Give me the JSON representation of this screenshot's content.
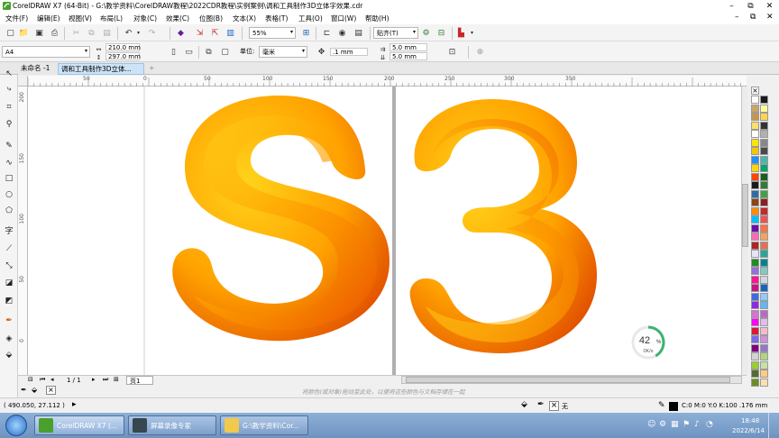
{
  "window": {
    "title": "CorelDRAW X7 (64-Bit) - G:\\教学资料\\CorelDRAW教程\\2022CDR教程\\实例案例\\调和工具制作3D立体字效果.cdr",
    "buttons": {
      "minimize": "–",
      "restore": "⧉",
      "close": "✕"
    }
  },
  "menu": {
    "items": [
      "文件(F)",
      "编辑(E)",
      "视图(V)",
      "布局(L)",
      "对象(C)",
      "效果(C)",
      "位图(B)",
      "文本(X)",
      "表格(T)",
      "工具(O)",
      "窗口(W)",
      "帮助(H)"
    ],
    "right_buttons": {
      "minimize": "–",
      "restore": "⧉",
      "close": "✕"
    }
  },
  "toolbar": {
    "zoom": "55%",
    "snap": "贴齐(T)"
  },
  "propertybar": {
    "page_size": "A4",
    "width": "210.0 mm",
    "height": "297.0 mm",
    "units_label": "单位:",
    "units": "毫米",
    "nudge": ".1 mm",
    "dup_x": "5.0 mm",
    "dup_y": "5.0 mm"
  },
  "tabs": {
    "items": [
      "未命名 -1",
      "调和工具制作3D立体..."
    ],
    "add": "+"
  },
  "rulers": {
    "top": [
      "50",
      "0",
      "50",
      "100",
      "150",
      "200",
      "250",
      "300",
      "350"
    ],
    "left": [
      "200",
      "150",
      "100",
      "50",
      "0"
    ]
  },
  "canvas": {
    "text": "S3",
    "colors": {
      "light": "#ffd21a",
      "mid": "#ffa200",
      "dark": "#ee5a00",
      "deep": "#e04a00"
    }
  },
  "speed": {
    "percent": "42",
    "unit": "%",
    "rate": "0K/s",
    "level": 0.42
  },
  "pagenav": {
    "page_counter": "1 / 1",
    "page_tab": "页1"
  },
  "hint": "将颜色(或对象)拖动至此处，以便将这些颜色与文档存储在一起",
  "status": {
    "coords": "( 490.050, 27.112 )",
    "fill": "无",
    "outline": "C:0 M:0 Y:0 K:100  .176 mm"
  },
  "taskbar": {
    "items": [
      "CorelDRAW X7 (...",
      "屏幕录像专家",
      "G:\\教学资料\\Cor..."
    ],
    "time": "18:48",
    "date": "2022/6/14"
  },
  "palette": {
    "col1": [
      "#ffffff",
      "#c8a56a",
      "#c8964a",
      "#ffe066",
      "#ffffff",
      "#ffe600",
      "#f0c800",
      "#1e90ff",
      "#ffd700",
      "#ff4500",
      "#1a1a1a",
      "#2e6da4",
      "#8b4513",
      "#ff8c00",
      "#00bfff",
      "#6a0dad",
      "#ff69b4",
      "#b22222",
      "#e6e6fa",
      "#228b22",
      "#9370db",
      "#ff1493",
      "#c71585",
      "#4169e1",
      "#8a2be2",
      "#da70d6",
      "#ff00ff",
      "#dc143c",
      "#7b68ee",
      "#800080",
      "#d3d3d3",
      "#9acd32",
      "#556b2f",
      "#6b8e23"
    ],
    "col2": [
      "#1a1a1a",
      "#ffff99",
      "#ffd54f",
      "#333333",
      "#b0b0b0",
      "#888888",
      "#4a4a4a",
      "#4db6ac",
      "#00a86b",
      "#1b5e20",
      "#2e7d32",
      "#43a047",
      "#8e1e1e",
      "#c62828",
      "#ef5350",
      "#ff7043",
      "#f4a261",
      "#e76f51",
      "#26a69a",
      "#00838f",
      "#80cbc4",
      "#cfd8dc",
      "#1565c0",
      "#90caf9",
      "#64b5f6",
      "#ba68c8",
      "#e1bee7",
      "#f8bbd0",
      "#ce93d8",
      "#9575cd",
      "#aed581",
      "#c5e1a5",
      "#ffcc80",
      "#ffe0b2"
    ]
  }
}
